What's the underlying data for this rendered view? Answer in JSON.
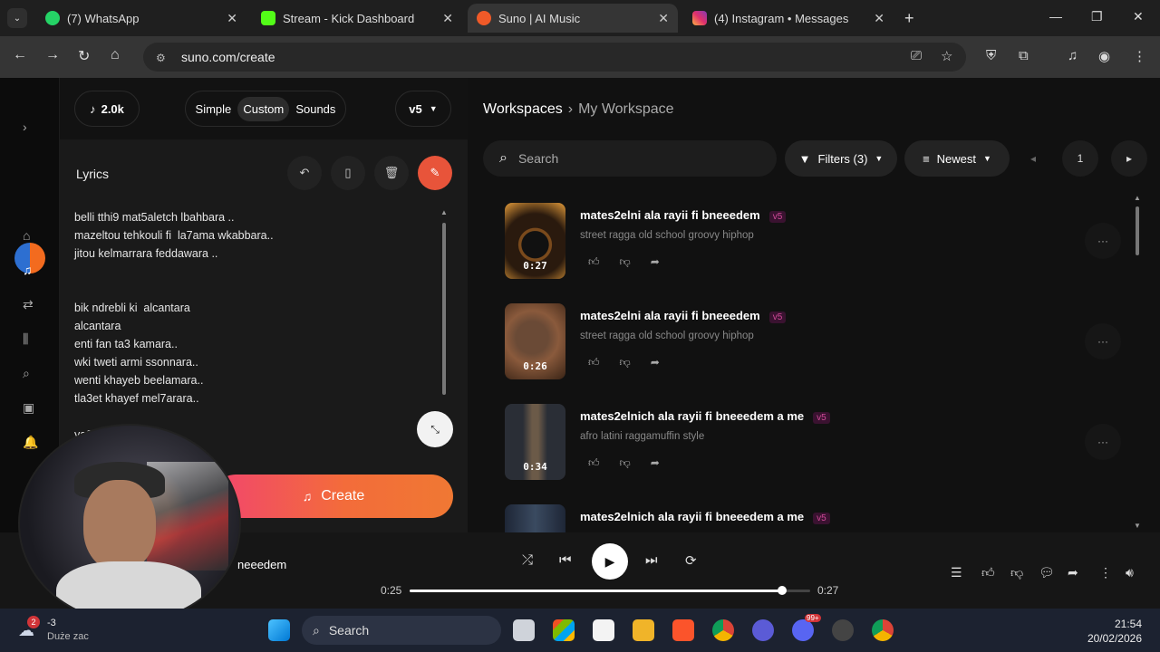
{
  "browser": {
    "tabs": [
      {
        "label": "(7) WhatsApp",
        "fav_color": "#25d366"
      },
      {
        "label": "Stream - Kick Dashboard",
        "fav_color": "#53fc18"
      },
      {
        "label": "Suno | AI Music",
        "fav_color": "#f05a28"
      },
      {
        "label": "(4) Instagram • Messages",
        "fav_color": "#e1306c"
      }
    ],
    "url": "suno.com/create"
  },
  "create_panel": {
    "credits": "2.0k",
    "modes": [
      "Simple",
      "Custom",
      "Sounds"
    ],
    "selected_mode": "Custom",
    "version": "v5",
    "lyrics_label": "Lyrics",
    "lyrics": "belli tthi9 mat5aletch lbahbara ..\nmazeltou tehkouli fi  la7ama wkabbara..\njitou kelmarrara feddawara ..\n\n\nbik ndrebli ki  alcantara\nalcantara\nenti fan ta3 kamara..\nwki tweti armi ssonnara..\nwenti khayeb beelamara..\ntla3et khayef mel7arara..\n\nya3...........ttara..",
    "create_label": "Create"
  },
  "workspace": {
    "breadcrumb_root": "Workspaces",
    "breadcrumb_current": "My Workspace",
    "search_placeholder": "Search",
    "filters_label": "Filters (3)",
    "sort_label": "Newest",
    "page": "1"
  },
  "songs": [
    {
      "title": "mates2elni ala rayii fi bneeedem",
      "version": "v5",
      "style": "street ragga old school groovy hiphop",
      "duration": "0:27"
    },
    {
      "title": "mates2elni ala rayii fi bneeedem",
      "version": "v5",
      "style": "street ragga old school groovy hiphop",
      "duration": "0:26"
    },
    {
      "title": "mates2elnich ala rayii fi bneeedem a me",
      "version": "v5",
      "style": "afro latini raggamuffin style",
      "duration": "0:34"
    },
    {
      "title": "mates2elnich ala rayii fi bneeedem a me",
      "version": "v5",
      "style": "",
      "duration": ""
    }
  ],
  "player": {
    "title": "neeedem",
    "current_time": "0:25",
    "total_time": "0:27",
    "progress": 0.93
  },
  "taskbar": {
    "weather_temp": "-3",
    "weather_cond": "Duże zac",
    "weather_badge": "2",
    "search": "Search",
    "time": "21:54",
    "date": "20/02/2026",
    "discord_badge": "99+"
  },
  "colors": {
    "accent": "#f36c3a",
    "version_tag": "#d04a98",
    "background": "#101010"
  }
}
